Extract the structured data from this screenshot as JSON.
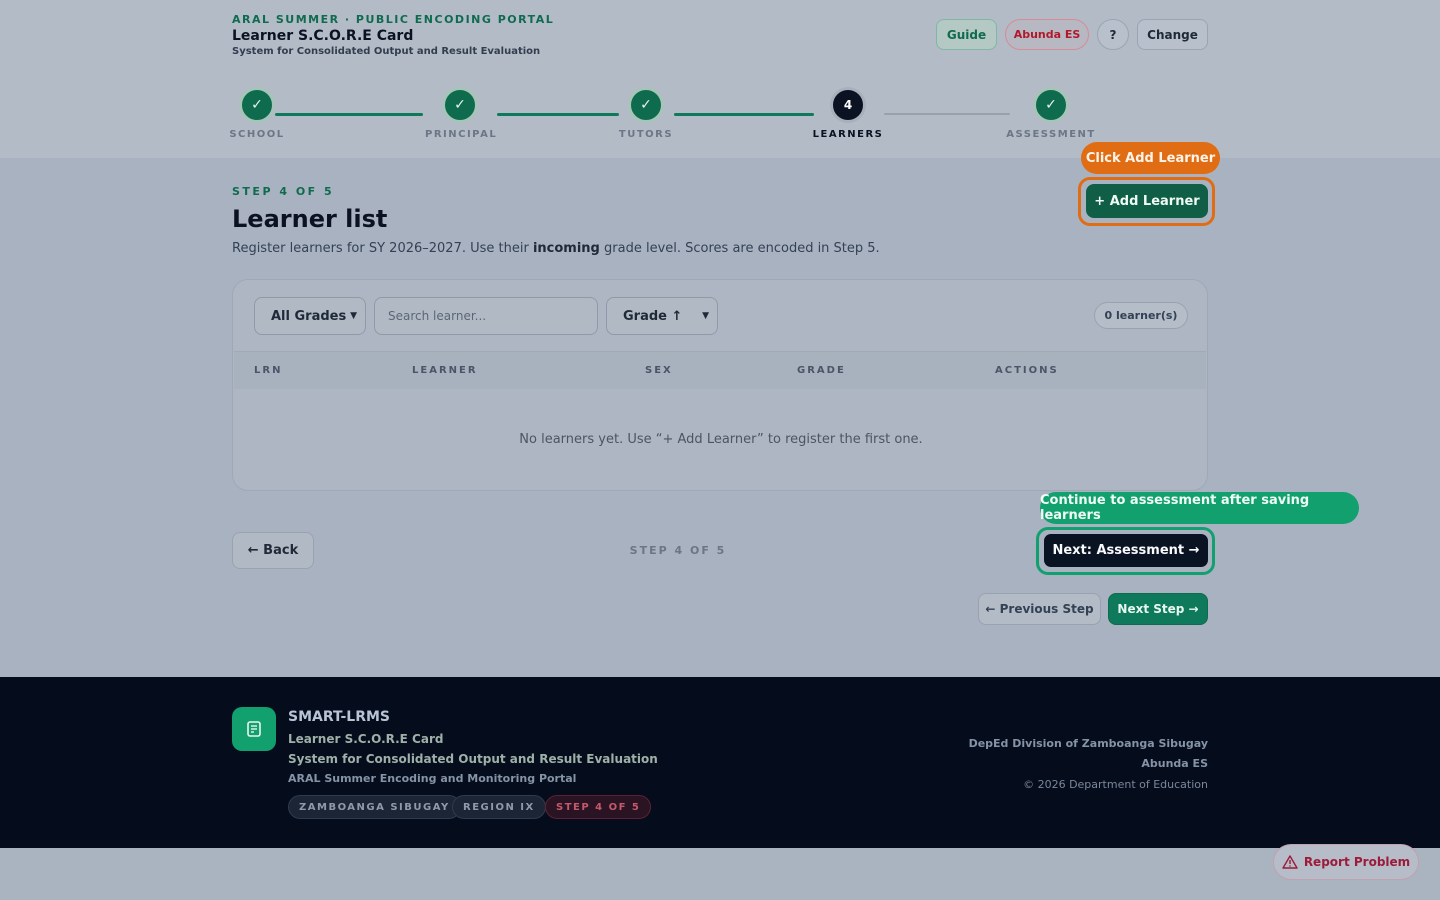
{
  "header": {
    "kicker": "ARAL SUMMER · PUBLIC ENCODING PORTAL",
    "title": "Learner S.C.O.R.E Card",
    "subtitle": "System for Consolidated Output and Result Evaluation",
    "guide_label": "Guide",
    "school_label": "Abunda ES",
    "help_label": "?",
    "change_label": "Change"
  },
  "stepper": {
    "steps": [
      {
        "label": "SCHOOL",
        "state": "done",
        "mark": "✓"
      },
      {
        "label": "PRINCIPAL",
        "state": "done",
        "mark": "✓"
      },
      {
        "label": "TUTORS",
        "state": "done",
        "mark": "✓"
      },
      {
        "label": "LEARNERS",
        "state": "current",
        "mark": "4"
      },
      {
        "label": "ASSESSMENT",
        "state": "done",
        "mark": "✓"
      }
    ]
  },
  "main": {
    "kicker": "STEP 4 OF 5",
    "title": "Learner list",
    "desc_before": "Register learners for SY 2026–2027. Use their ",
    "desc_bold": "incoming",
    "desc_after": " grade level. Scores are encoded in Step 5.",
    "add_callout": "Click Add Learner",
    "add_button": "+ Add Learner"
  },
  "table": {
    "grade_filter": "All Grades",
    "search_placeholder": "Search learner...",
    "sort": "Grade ↑",
    "count": "0 learner(s)",
    "columns": [
      "LRN",
      "LEARNER",
      "SEX",
      "GRADE",
      "ACTIONS"
    ],
    "empty_message": "No learners yet. Use “+ Add Learner” to register the first one."
  },
  "nav": {
    "back": "← Back",
    "step_indicator": "STEP 4 OF 5",
    "next_callout": "Continue to assessment after saving learners",
    "next_button": "Next: Assessment →",
    "prev_step": "← Previous Step",
    "next_step": "Next Step →"
  },
  "footer": {
    "name": "SMART-LRMS",
    "line1": "Learner S.C.O.R.E Card",
    "line2": "System for Consolidated Output and Result Evaluation",
    "line3": "ARAL Summer Encoding and Monitoring Portal",
    "tags": [
      "ZAMBOANGA SIBUGAY",
      "REGION IX",
      "STEP 4 OF 5"
    ],
    "division": "DepEd Division of Zamboanga Sibugay",
    "school": "Abunda ES",
    "copyright": "© 2026 Department of Education"
  },
  "report_label": "Report Problem",
  "colors": {
    "accent_green": "#0f7a5b",
    "callout_orange": "#e06c14",
    "callout_green": "#13a06f",
    "navy": "#0a1322"
  }
}
